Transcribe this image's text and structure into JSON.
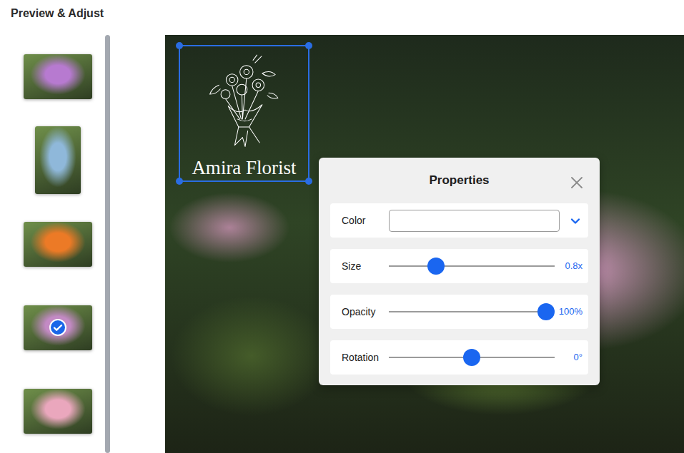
{
  "title": "Preview & Adjust",
  "thumbnails": [
    {
      "kind": "landscape",
      "selected": false,
      "color": "#b77ad0"
    },
    {
      "kind": "portrait",
      "selected": false,
      "color": "#8fb8da"
    },
    {
      "kind": "landscape",
      "selected": false,
      "color": "#ec7a26"
    },
    {
      "kind": "landscape",
      "selected": true,
      "color": "#c38ac4"
    },
    {
      "kind": "landscape",
      "selected": false,
      "color": "#eaa7bd"
    }
  ],
  "canvas": {
    "logo": {
      "text": "Amira Florist",
      "selected": true
    }
  },
  "properties": {
    "title": "Properties",
    "rows": [
      {
        "kind": "color",
        "label": "Color",
        "value": ""
      },
      {
        "kind": "slider",
        "label": "Size",
        "level": 0.26,
        "reading": "0.8x"
      },
      {
        "kind": "slider",
        "label": "Opacity",
        "level": 1.0,
        "reading": "100%"
      },
      {
        "kind": "slider",
        "label": "Rotation",
        "level": 0.5,
        "reading": "0°"
      }
    ]
  }
}
